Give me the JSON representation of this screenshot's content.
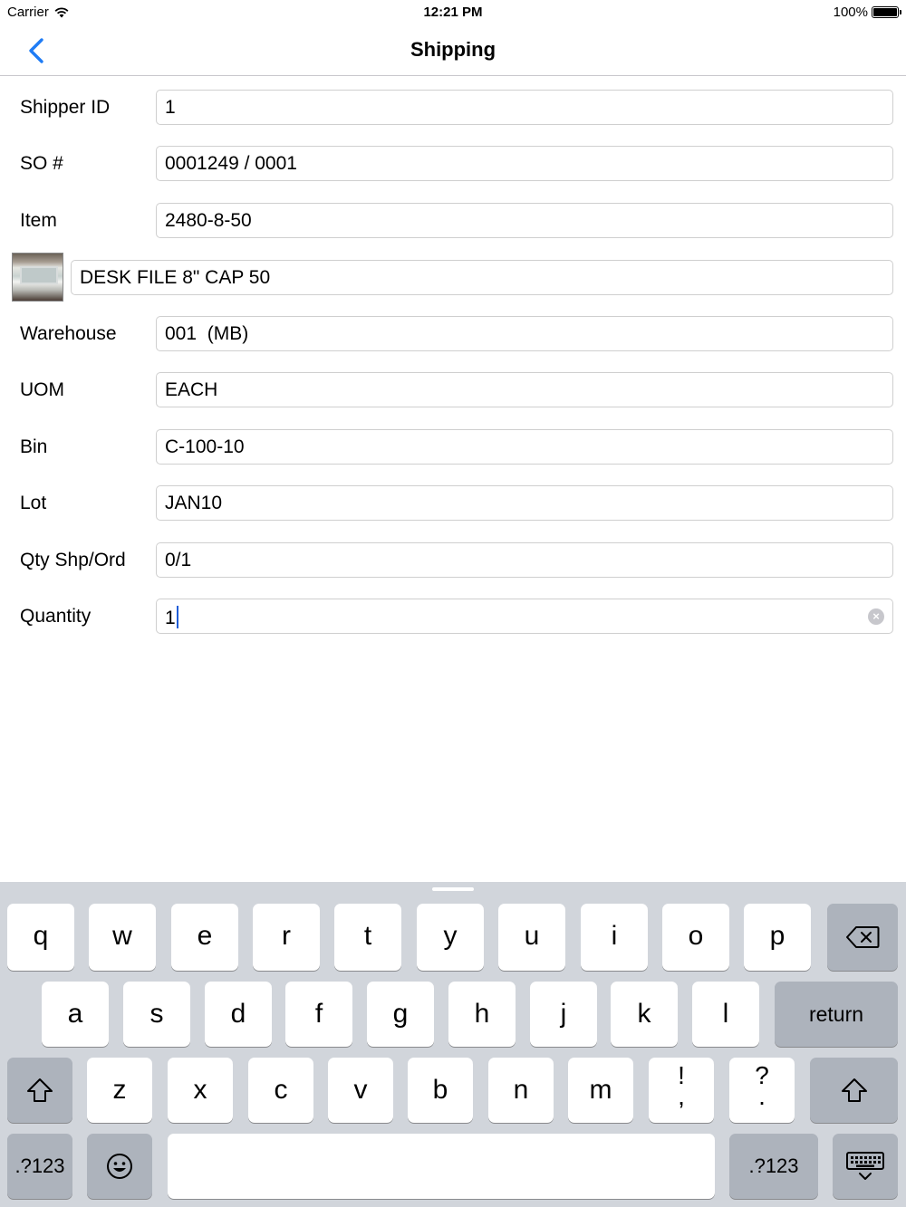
{
  "status_bar": {
    "carrier": "Carrier",
    "time": "12:21 PM",
    "battery": "100%"
  },
  "nav": {
    "title": "Shipping"
  },
  "form": {
    "shipper_id": {
      "label": "Shipper ID",
      "value": "1"
    },
    "so_number": {
      "label": "SO #",
      "value": "0001249 / 0001"
    },
    "item": {
      "label": "Item",
      "value": "2480-8-50"
    },
    "description": {
      "value": "DESK FILE 8\" CAP 50"
    },
    "warehouse": {
      "label": "Warehouse",
      "value": "001  (MB)"
    },
    "uom": {
      "label": "UOM",
      "value": "EACH"
    },
    "bin": {
      "label": "Bin",
      "value": "C-100-10"
    },
    "lot": {
      "label": "Lot",
      "value": "JAN10"
    },
    "qty_shp_ord": {
      "label": "Qty Shp/Ord",
      "value": "0/1"
    },
    "quantity": {
      "label": "Quantity",
      "value": "1"
    }
  },
  "keyboard": {
    "row1": [
      "q",
      "w",
      "e",
      "r",
      "t",
      "y",
      "u",
      "i",
      "o",
      "p"
    ],
    "row2": [
      "a",
      "s",
      "d",
      "f",
      "g",
      "h",
      "j",
      "k",
      "l"
    ],
    "row3": [
      "z",
      "x",
      "c",
      "v",
      "b",
      "n",
      "m"
    ],
    "exclaim_top": "!",
    "exclaim_bottom": ",",
    "question_top": "?",
    "question_bottom": ".",
    "return_label": "return",
    "numbers_label": ".?123",
    "accent_color": "#1f5ed8",
    "icons": [
      "backspace-icon",
      "shift-icon",
      "emoji-icon",
      "dismiss-keyboard-icon",
      "wifi-icon",
      "battery-icon",
      "back-chevron-icon",
      "clear-icon"
    ]
  }
}
